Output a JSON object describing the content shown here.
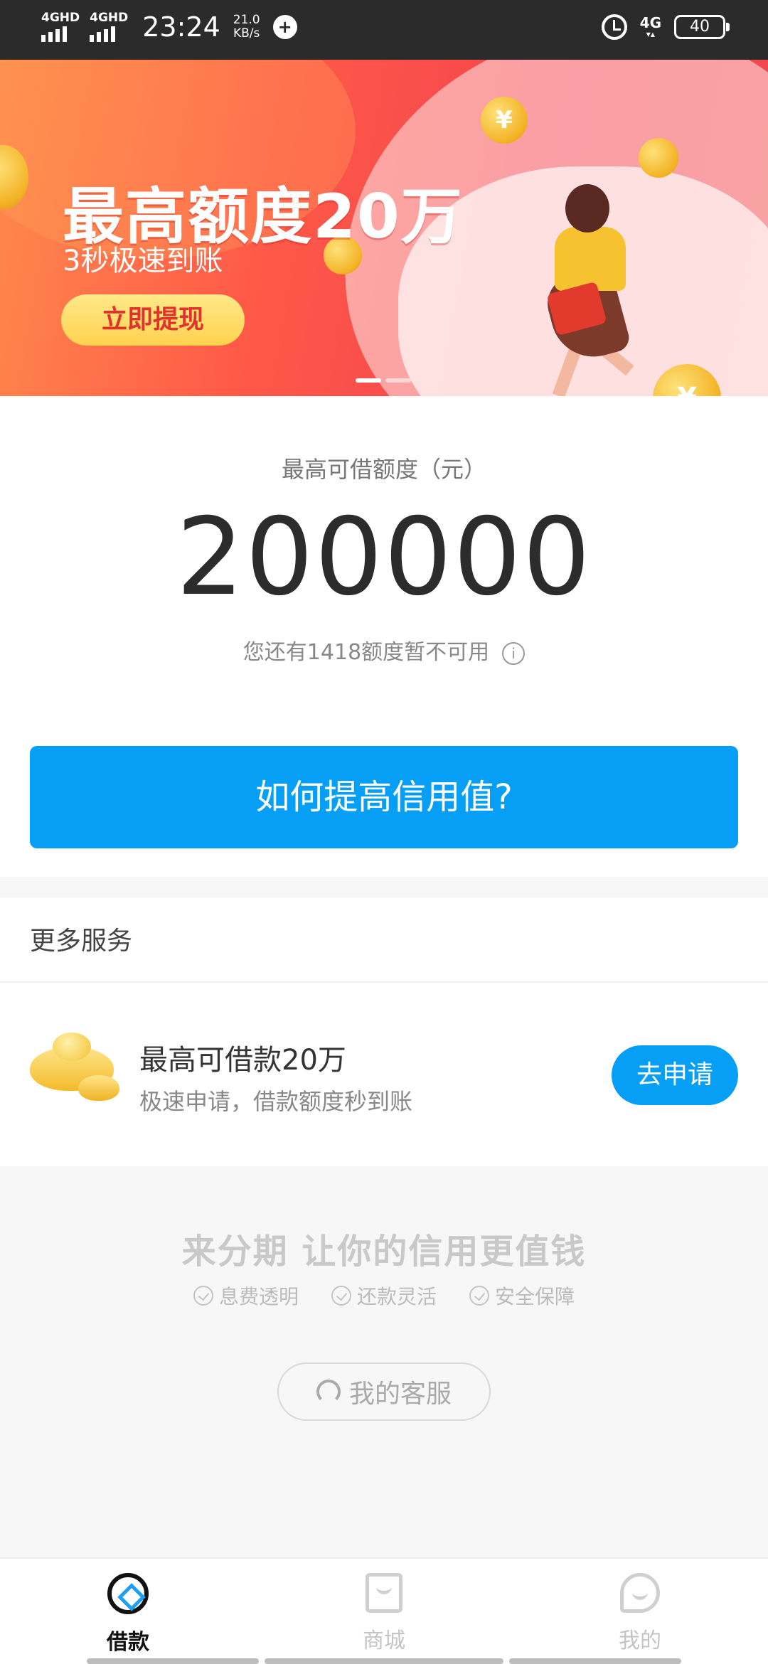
{
  "status_bar": {
    "signal_1": "4GHD",
    "signal_2": "4GHD",
    "time": "23:24",
    "speed_value": "21.0",
    "speed_unit": "KB/s",
    "network": "4G",
    "battery": "40"
  },
  "banner": {
    "title": "最高额度20万",
    "subtitle": "3秒极速到账",
    "button": "立即提现",
    "coin_symbol": "¥",
    "slide_count": 2,
    "active_slide": 1
  },
  "credit": {
    "label": "最高可借额度（元）",
    "amount": "200000",
    "note": "您还有1418额度暂不可用",
    "info_icon": "i",
    "cta": "如何提高信用值?"
  },
  "services": {
    "title": "更多服务",
    "item": {
      "title": "最高可借款20万",
      "subtitle": "极速申请，借款额度秒到账",
      "button": "去申请"
    }
  },
  "footer": {
    "slogan": "来分期 让你的信用更值钱",
    "features": [
      "息费透明",
      "还款灵活",
      "安全保障"
    ],
    "support_button": "我的客服"
  },
  "bottom_nav": {
    "items": [
      {
        "label": "借款",
        "icon": "borrow-icon",
        "active": true
      },
      {
        "label": "商城",
        "icon": "mall-icon",
        "active": false
      },
      {
        "label": "我的",
        "icon": "profile-icon",
        "active": false
      }
    ]
  },
  "colors": {
    "primary": "#069ff5",
    "banner_red": "#f2424f",
    "banner_button": "#ffd24e",
    "text_dark": "#333333"
  }
}
